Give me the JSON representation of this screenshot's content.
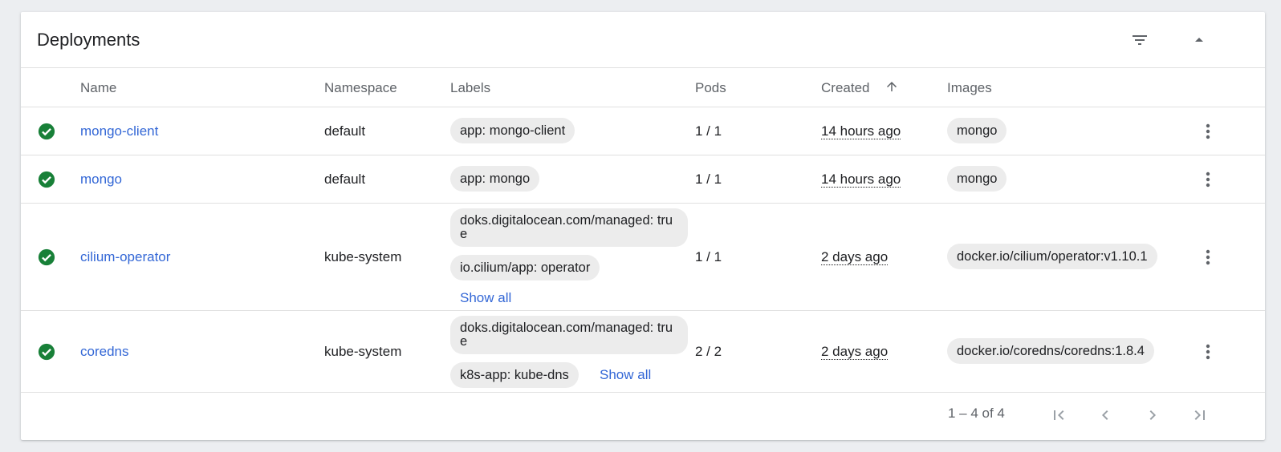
{
  "card": {
    "title": "Deployments",
    "filter_icon": "filter-icon",
    "collapse_icon": "collapse-arrow-icon"
  },
  "columns": {
    "name": "Name",
    "namespace": "Namespace",
    "labels": "Labels",
    "pods": "Pods",
    "created": "Created",
    "images": "Images",
    "sort_icon": "arrow-upward-icon"
  },
  "rows": [
    {
      "status_icon": "check-circle-icon",
      "name": "mongo-client",
      "namespace": "default",
      "labels": [
        "app: mongo-client"
      ],
      "pods": "1 / 1",
      "created": "14 hours ago",
      "image": "mongo"
    },
    {
      "status_icon": "check-circle-icon",
      "name": "mongo",
      "namespace": "default",
      "labels": [
        "app: mongo"
      ],
      "pods": "1 / 1",
      "created": "14 hours ago",
      "image": "mongo"
    },
    {
      "status_icon": "check-circle-icon",
      "name": "cilium-operator",
      "namespace": "kube-system",
      "labels": [
        "doks.digitalocean.com/managed: true",
        "io.cilium/app: operator"
      ],
      "show_all": "Show all",
      "pods": "1 / 1",
      "created": "2 days ago",
      "image": "docker.io/cilium/operator:v1.10.1"
    },
    {
      "status_icon": "check-circle-icon",
      "name": "coredns",
      "namespace": "kube-system",
      "labels": [
        "doks.digitalocean.com/managed: true",
        "k8s-app: kube-dns"
      ],
      "show_all": "Show all",
      "pods": "2 / 2",
      "created": "2 days ago",
      "image": "docker.io/coredns/coredns:1.8.4"
    }
  ],
  "paginator": {
    "range_label": "1 – 4 of 4",
    "first_icon": "first-page-icon",
    "prev_icon": "chevron-left-icon",
    "next_icon": "chevron-right-icon",
    "last_icon": "last-page-icon"
  },
  "colors": {
    "success": "#188038",
    "link": "#3367d6",
    "chip_bg": "#ececec",
    "muted": "#5f6368"
  }
}
